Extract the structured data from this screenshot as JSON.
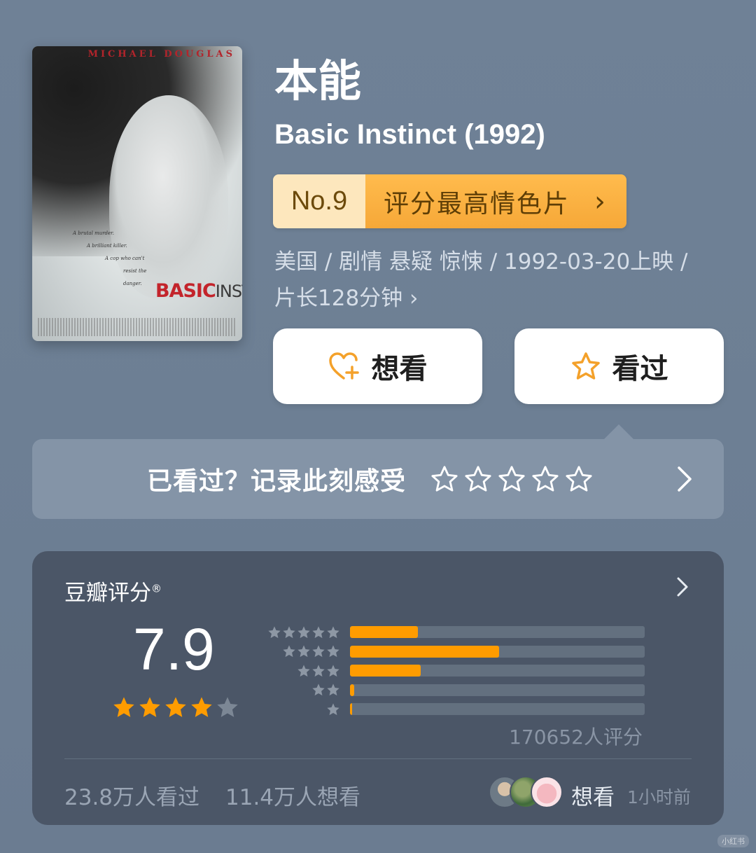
{
  "poster": {
    "actor": "MICHAEL DOUGLAS",
    "tagline": [
      "A brutal murder.",
      "A brilliant killer.",
      "A cop who can't",
      "resist the danger."
    ],
    "title_a": "BASIC",
    "title_b": "INSTINCT"
  },
  "movie": {
    "title_zh": "本能",
    "title_en": "Basic Instinct (1992)"
  },
  "rank": {
    "number": "No.9",
    "label": "评分最高情色片",
    "chevron": "›"
  },
  "meta": {
    "line1": "美国 / 剧情 悬疑 惊悚 / 1992-03-20上映 /",
    "line2": "片长128分钟",
    "chevron": "›"
  },
  "actions": {
    "want_label": "想看",
    "want_icon": "heart-plus-icon",
    "seen_label": "看过",
    "seen_icon": "star-outline-icon"
  },
  "record": {
    "prompt": "已看过？记录此刻感受",
    "star_count": 5
  },
  "rating": {
    "heading": "豆瓣评分",
    "trademark": "®",
    "score": "7.9",
    "stars_filled": 4,
    "stars_total": 5,
    "distribution": [
      {
        "stars": 5,
        "fraction": 0.23
      },
      {
        "stars": 4,
        "fraction": 0.505
      },
      {
        "stars": 3,
        "fraction": 0.24
      },
      {
        "stars": 2,
        "fraction": 0.015
      },
      {
        "stars": 1,
        "fraction": 0.004
      }
    ],
    "count": "170652人评分",
    "seen_count": "23.8万人看过",
    "want_count": "11.4万人想看",
    "friend_action": "想看",
    "friend_time": "1小时前"
  },
  "colors": {
    "background": "#6f8196",
    "card": "#4b5667",
    "accent_orange": "#ff9c00",
    "rank_badge": "#ffbb4d"
  },
  "watermark": "小红书"
}
